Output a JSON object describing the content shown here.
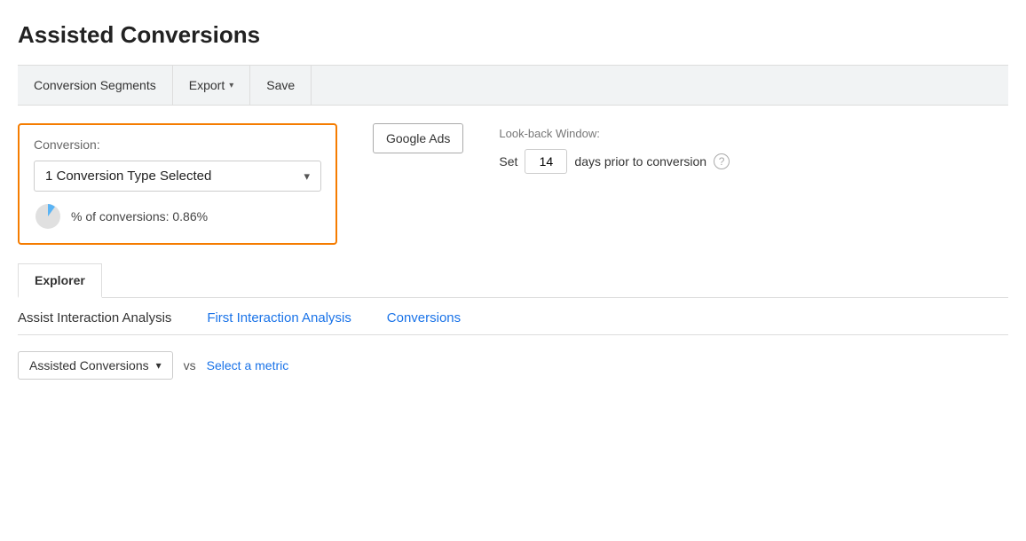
{
  "page": {
    "title": "Assisted Conversions"
  },
  "toolbar": {
    "conversion_segments_label": "Conversion Segments",
    "export_label": "Export",
    "save_label": "Save"
  },
  "conversion_box": {
    "label": "Conversion:",
    "dropdown_value": "1 Conversion Type Selected",
    "stats_text": "% of conversions: 0.86%",
    "pie_percentage": 0.86
  },
  "google_ads_button": {
    "label": "Google Ads"
  },
  "lookback": {
    "title": "Look-back Window:",
    "set_label": "Set",
    "days_value": "14",
    "suffix": "days prior to conversion"
  },
  "tabs": [
    {
      "label": "Explorer",
      "active": true
    }
  ],
  "analysis_links": [
    {
      "label": "Assist Interaction Analysis",
      "active": true
    },
    {
      "label": "First Interaction Analysis",
      "active": false
    },
    {
      "label": "Conversions",
      "active": false
    }
  ],
  "metric_row": {
    "dropdown_label": "Assisted Conversions",
    "vs_label": "vs",
    "select_metric_label": "Select a metric"
  },
  "icons": {
    "chevron_down": "▾",
    "question_mark": "?"
  }
}
